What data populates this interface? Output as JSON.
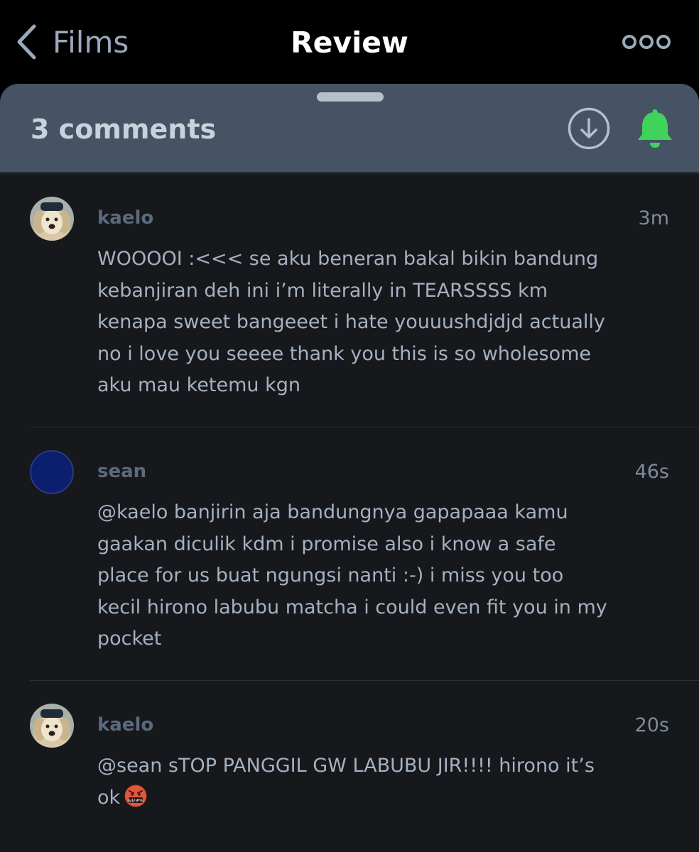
{
  "nav": {
    "back_label": "Films",
    "title": "Review",
    "back_icon": "chevron-left-icon",
    "more_icon": "more-dots-icon"
  },
  "sheet": {
    "comment_count": "3 comments",
    "download_icon": "download-circle-icon",
    "bell_icon": "bell-icon"
  },
  "colors": {
    "header_bg": "#455365",
    "sheet_bg": "#16181c",
    "bell_accent": "#40d35c",
    "avatar_blue": "#0c1e6e"
  },
  "comments": [
    {
      "username": "kaelo",
      "time": "3m",
      "avatar": "dog-photo-avatar",
      "text": "WOOOOI :<<< se aku beneran bakal bikin bandung kebanjiran deh ini i’m literally in TEARSSSS km kenapa sweet bangeeet i hate youuushdjdjd actually no i love you seeee thank you this is so wholesome aku mau ketemu kgn"
    },
    {
      "username": "sean",
      "time": "46s",
      "avatar": "blue-circle-avatar",
      "text": "@kaelo banjirin aja bandungnya gapapaaa kamu gaakan diculik kdm i promise also i know a safe place for us buat ngungsi nanti :-) i miss you too kecil hirono labubu matcha i could even fit you in my pocket"
    },
    {
      "username": "kaelo",
      "time": "20s",
      "avatar": "dog-photo-avatar",
      "text": "@sean sTOP PANGGIL GW LABUBU JIR!!!! hirono it’s ok",
      "emoji": "🤬",
      "emoji_icon": "cursing-face-emoji"
    }
  ]
}
